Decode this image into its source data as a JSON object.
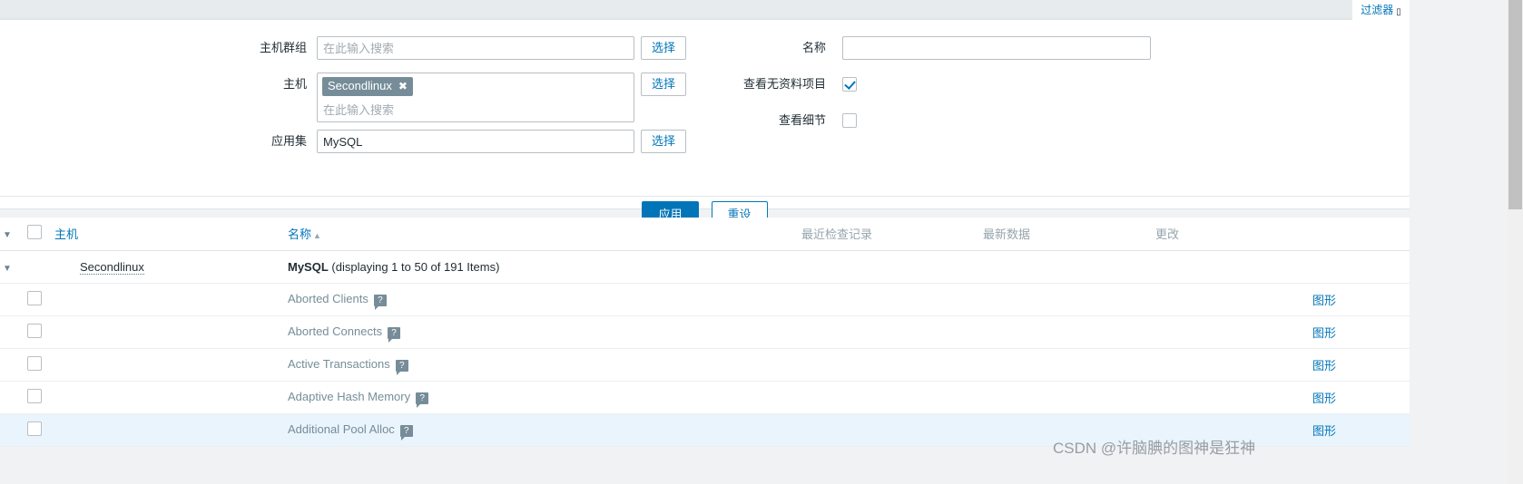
{
  "filter_tab": {
    "label": "过滤器",
    "caret_icon": "filter-caret-icon"
  },
  "filter": {
    "host_group": {
      "label": "主机群组",
      "value": "",
      "placeholder": "在此输入搜索",
      "select_button": "选择"
    },
    "host": {
      "label": "主机",
      "chip": "Secondlinux",
      "chip_remove_icon": "✖",
      "placeholder": "在此输入搜索",
      "select_button": "选择"
    },
    "application": {
      "label": "应用集",
      "value": "MySQL",
      "placeholder": "",
      "select_button": "选择"
    },
    "name": {
      "label": "名称",
      "value": "",
      "placeholder": ""
    },
    "show_items_without_data": {
      "label": "查看无资料项目",
      "checked": true
    },
    "show_details": {
      "label": "查看细节",
      "checked": false
    },
    "apply_button": "应用",
    "reset_button": "重设"
  },
  "table": {
    "headers": {
      "host": "主机",
      "name": "名称",
      "sort_arrow": "▲",
      "last_check": "最近检查记录",
      "latest_data": "最新数据",
      "change": "更改"
    },
    "group_row": {
      "host": "Secondlinux",
      "app_name": "MySQL",
      "app_count": " (displaying 1 to 50 of 191 Items)",
      "caret_icon": "collapse-caret-icon"
    },
    "rows": [
      {
        "name": "Aborted Clients",
        "hint": "?",
        "graph": "图形",
        "alt": false
      },
      {
        "name": "Aborted Connects",
        "hint": "?",
        "graph": "图形",
        "alt": false
      },
      {
        "name": "Active Transactions",
        "hint": "?",
        "graph": "图形",
        "alt": false
      },
      {
        "name": "Adaptive Hash Memory",
        "hint": "?",
        "graph": "图形",
        "alt": false
      },
      {
        "name": "Additional Pool Alloc",
        "hint": "?",
        "graph": "图形",
        "alt": true
      }
    ]
  },
  "watermark": "CSDN @许脑腆的图神是狂神",
  "colors": {
    "accent": "#0275b8",
    "chip_bg": "#768d99",
    "row_alt_bg": "#e9f4fd",
    "muted_text": "#768d99"
  }
}
